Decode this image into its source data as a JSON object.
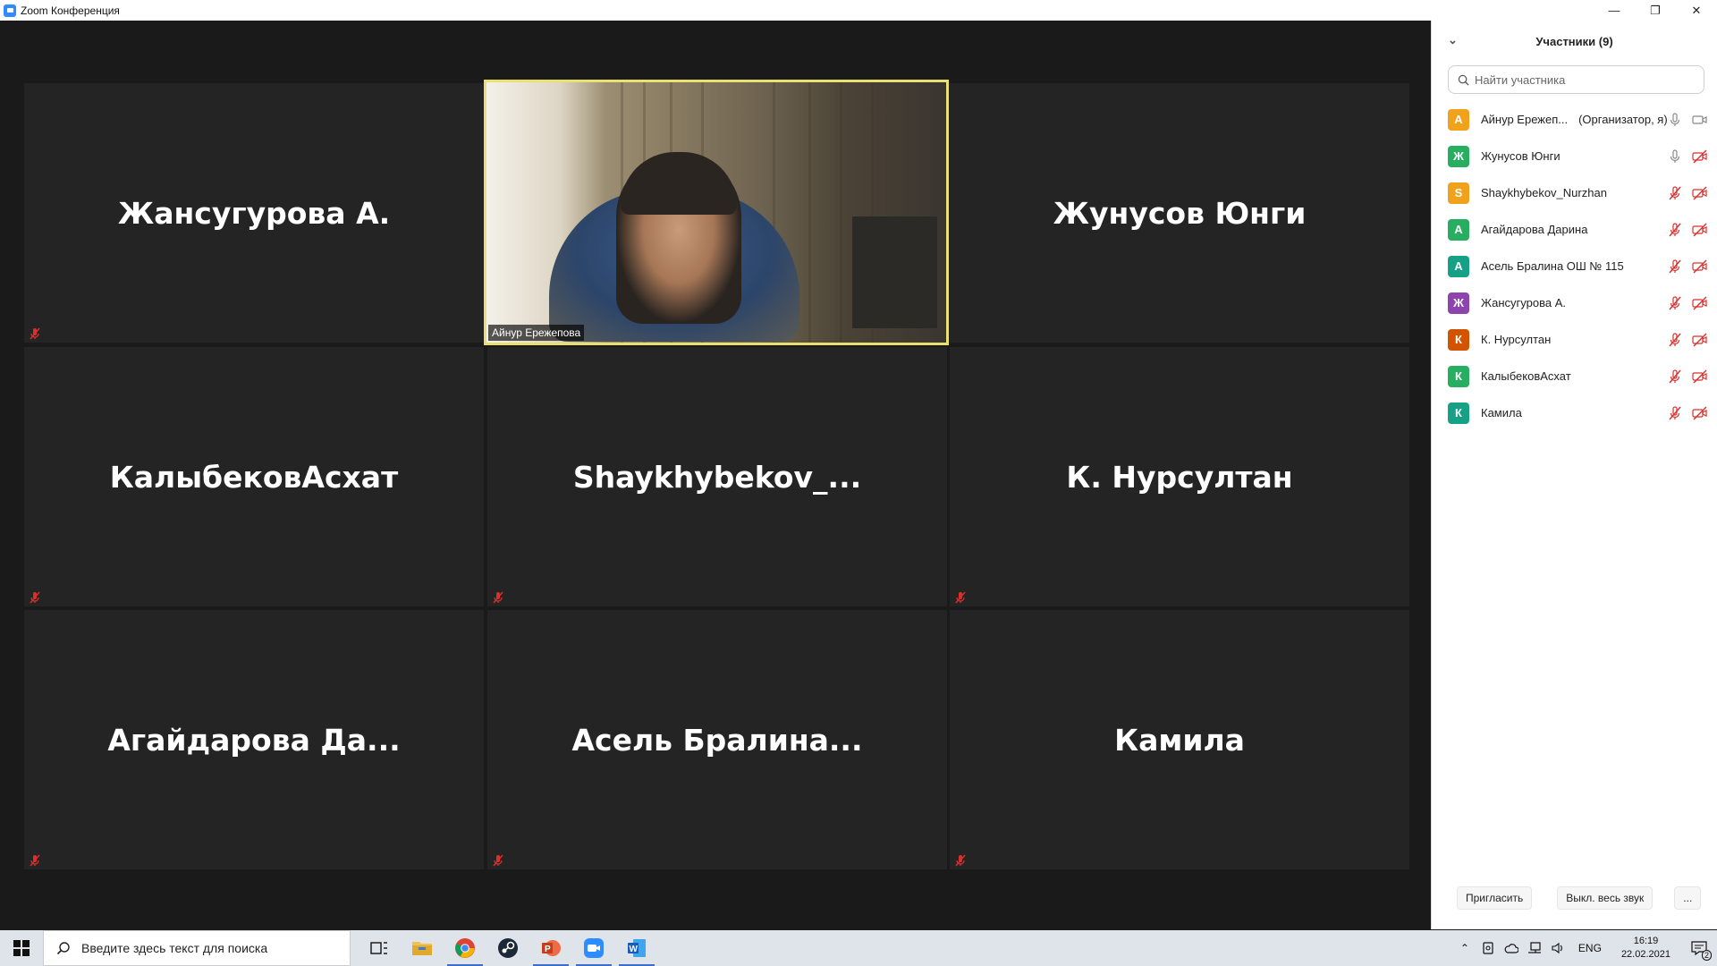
{
  "window": {
    "title": "Zoom Конференция",
    "controls": {
      "minimize": "—",
      "restore": "❐",
      "close": "✕"
    }
  },
  "gallery": {
    "tiles": [
      {
        "name": "Жансугурова А.",
        "muted": true
      },
      {
        "name": "Айнур Ережепова",
        "video": true,
        "active_speaker": true
      },
      {
        "name": "Жунусов Юнги",
        "muted": false
      },
      {
        "name": "КалыбековАсхат",
        "muted": true
      },
      {
        "name": "Shaykhybekov_...",
        "muted": true
      },
      {
        "name": "К. Нурсултан",
        "muted": true
      },
      {
        "name": "Агайдарова  Да...",
        "muted": true
      },
      {
        "name": "Асель  Бралина...",
        "muted": true
      },
      {
        "name": "Камила",
        "muted": true
      }
    ]
  },
  "participants_panel": {
    "title": "Участники (9)",
    "search_placeholder": "Найти участника",
    "participants": [
      {
        "initial": "А",
        "color": "#f0a21c",
        "name": "Айнур Ережеп...",
        "role": "(Организатор, я)",
        "mic": "on",
        "video": "on"
      },
      {
        "initial": "Ж",
        "color": "#27ae60",
        "name": "Жунусов Юнги",
        "role": "",
        "mic": "on",
        "video": "off"
      },
      {
        "initial": "S",
        "color": "#f0a21c",
        "name": "Shaykhybekov_Nurzhan",
        "role": "",
        "mic": "off",
        "video": "off"
      },
      {
        "initial": "А",
        "color": "#27ae60",
        "name": "Агайдарова Дарина",
        "role": "",
        "mic": "off",
        "video": "off"
      },
      {
        "initial": "А",
        "color": "#16a085",
        "name": "Асель Бралина ОШ № 115",
        "role": "",
        "mic": "off",
        "video": "off"
      },
      {
        "initial": "Ж",
        "color": "#8e44ad",
        "name": "Жансугурова А.",
        "role": "",
        "mic": "off",
        "video": "off"
      },
      {
        "initial": "К",
        "color": "#d35400",
        "name": "К. Нурсултан",
        "role": "",
        "mic": "off",
        "video": "off"
      },
      {
        "initial": "К",
        "color": "#27ae60",
        "name": "КалыбековАсхат",
        "role": "",
        "mic": "off",
        "video": "off"
      },
      {
        "initial": "К",
        "color": "#16a085",
        "name": "Камила",
        "role": "",
        "mic": "off",
        "video": "off"
      }
    ],
    "footer": {
      "invite": "Пригласить",
      "mute_all": "Выкл. весь звук",
      "more": "..."
    }
  },
  "taskbar": {
    "search_placeholder": "Введите здесь текст для поиска",
    "apps": [
      "task-view",
      "file-explorer",
      "chrome",
      "steam",
      "powerpoint",
      "zoom",
      "word"
    ],
    "language": "ENG",
    "time": "16:19",
    "date": "22.02.2021",
    "notifications": "2"
  },
  "colors": {
    "active_border": "#e8e070",
    "muted_red": "#d9302c",
    "tile_bg": "#242424"
  }
}
